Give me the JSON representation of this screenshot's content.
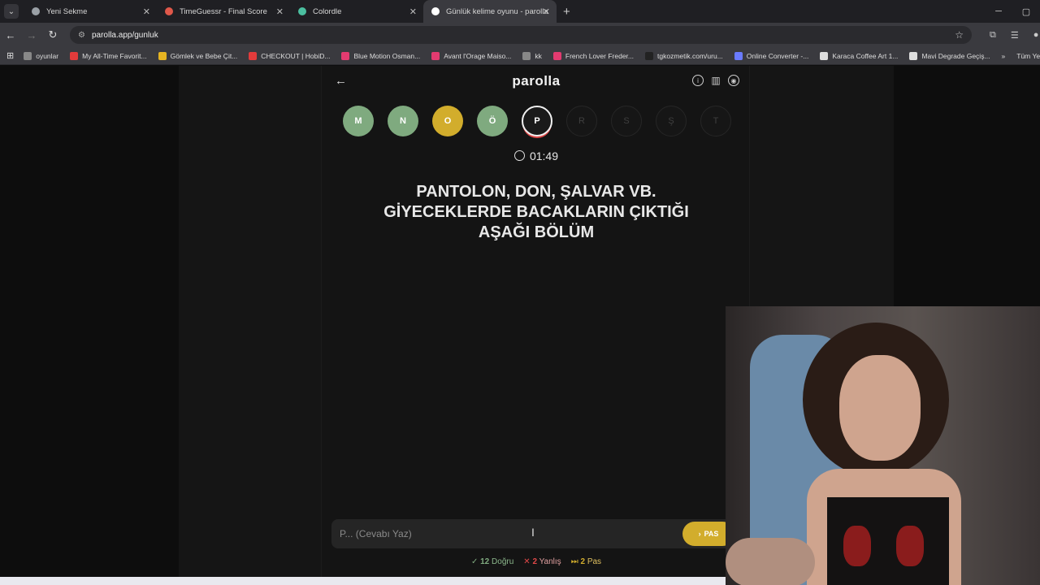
{
  "browser": {
    "tabs": [
      {
        "title": "Yeni Sekme",
        "color": "#9aa0a6"
      },
      {
        "title": "TimeGuessr - Final Score",
        "color": "#e0584a"
      },
      {
        "title": "Colordle",
        "color": "#4bbfa0"
      },
      {
        "title": "Günlük kelime oyunu - parolla",
        "color": "#ffffff"
      }
    ],
    "url": "parolla.app/gunluk",
    "bookmarks": [
      {
        "label": "oyunlar",
        "color": "#888888"
      },
      {
        "label": "My All-Time Favorit...",
        "color": "#e23b3b"
      },
      {
        "label": "Gömlek ve Bebe Çit...",
        "color": "#e6b422"
      },
      {
        "label": "CHECKOUT | HobiD...",
        "color": "#e23b3b"
      },
      {
        "label": "Blue Motion Osman...",
        "color": "#e23b70"
      },
      {
        "label": "Avant l'Orage Maiso...",
        "color": "#e23b70"
      },
      {
        "label": "kk",
        "color": "#888888"
      },
      {
        "label": "French Lover Freder...",
        "color": "#e23b70"
      },
      {
        "label": "tgkozmetik.com/uru...",
        "color": "#222222"
      },
      {
        "label": "Online Converter -...",
        "color": "#6a7bff"
      },
      {
        "label": "Karaca Coffee Art 1...",
        "color": "#dddddd"
      },
      {
        "label": "Mavi Degrade Geçiş...",
        "color": "#dddddd"
      }
    ],
    "bookmarks_all": "Tüm Yer İ"
  },
  "game": {
    "logo": "parolla",
    "letters": [
      {
        "ch": "M",
        "state": "correct"
      },
      {
        "ch": "N",
        "state": "correct"
      },
      {
        "ch": "O",
        "state": "wrong"
      },
      {
        "ch": "Ö",
        "state": "correct"
      },
      {
        "ch": "P",
        "state": "current"
      },
      {
        "ch": "R",
        "state": "pending"
      },
      {
        "ch": "S",
        "state": "pending"
      },
      {
        "ch": "Ş",
        "state": "pending"
      },
      {
        "ch": "T",
        "state": "pending"
      }
    ],
    "timer": "01:49",
    "question_lines": [
      "PANTOLON, DON, ŞALVAR VB.",
      "GİYECEKLERDE BACAKLARIN ÇIKTIĞI",
      "AŞAĞI BÖLÜM"
    ],
    "answer_placeholder": "P... (Cevabı Yaz)",
    "pass_label": "PAS",
    "stats": {
      "correct_count": "12",
      "correct_label": "Doğru",
      "wrong_count": "2",
      "wrong_label": "Yanlış",
      "pass_count": "2",
      "pass_label": "Pas"
    }
  }
}
